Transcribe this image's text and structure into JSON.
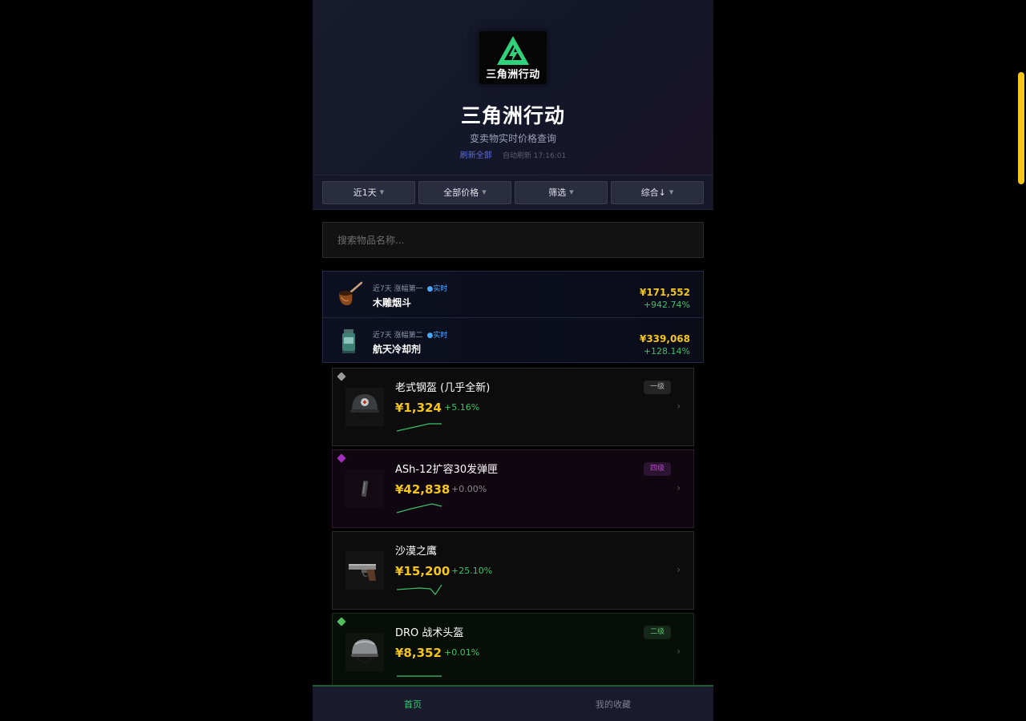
{
  "header": {
    "logo_text": "三角洲行动",
    "title": "三角洲行动",
    "subtitle": "变卖物实时价格查询",
    "refresh_all": "刷新全部",
    "auto_refresh": "自动刷新 17:16:01"
  },
  "filters": [
    {
      "label": "近1天"
    },
    {
      "label": "全部价格"
    },
    {
      "label": "筛选"
    },
    {
      "label": "综合↓"
    }
  ],
  "search": {
    "placeholder": "搜索物品名称..."
  },
  "top_movers": [
    {
      "label": "近7天 涨幅第一",
      "live": "●实时",
      "name": "木雕烟斗",
      "price": "¥171,552",
      "change": "+942.74%",
      "icon": "pipe-icon"
    },
    {
      "label": "近7天 涨幅第二",
      "live": "●实时",
      "name": "航天冷却剂",
      "price": "¥339,068",
      "change": "+128.14%",
      "icon": "coolant-icon"
    }
  ],
  "items": [
    {
      "name": "老式钢盔 (几乎全新)",
      "price": "¥1,324",
      "change": "+5.16%",
      "grade": "一级",
      "rarity_color": "#9a9a9a",
      "icon": "helmet-icon"
    },
    {
      "name": "ASh-12扩容30发弹匣",
      "price": "¥42,838",
      "change": "+0.00%",
      "grade": "四级",
      "rarity_color": "#a12fbf",
      "icon": "magazine-icon"
    },
    {
      "name": "沙漠之鹰",
      "price": "¥15,200",
      "change": "+25.10%",
      "grade": "",
      "rarity_color": "",
      "icon": "pistol-icon"
    },
    {
      "name": "DRO 战术头盔",
      "price": "¥8,352",
      "change": "+0.01%",
      "grade": "二级",
      "rarity_color": "#4fbf5f",
      "icon": "tactical-helmet-icon"
    }
  ],
  "chevron": "›",
  "nav": {
    "home": "首页",
    "favorites": "我的收藏"
  },
  "colors": {
    "price": "#f5c518",
    "up": "#3fbf6a",
    "accent": "#2fcf73",
    "link": "#5d6fd6"
  }
}
